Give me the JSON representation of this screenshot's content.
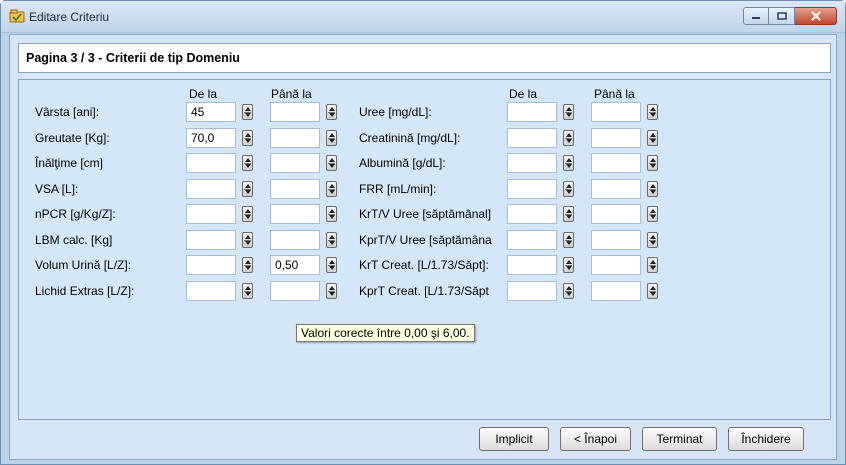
{
  "window": {
    "title": "Editare Criteriu"
  },
  "page_title": "Pagina 3 / 3 - Criterii de tip Domeniu",
  "col_headers": {
    "left_from": "De la",
    "left_to": "Până la",
    "right_from": "De la",
    "right_to": "Până la"
  },
  "left_rows": [
    {
      "label": "Vârsta [ani]:",
      "from": "45",
      "to": ""
    },
    {
      "label": "Greutate [Kg]:",
      "from": "70,0",
      "to": ""
    },
    {
      "label": "Înălţime [cm]",
      "from": "",
      "to": ""
    },
    {
      "label": "VSA [L]:",
      "from": "",
      "to": ""
    },
    {
      "label": "nPCR [g/Kg/Z]:",
      "from": "",
      "to": ""
    },
    {
      "label": "LBM calc. [Kg]",
      "from": "",
      "to": ""
    },
    {
      "label": "Volum Urină [L/Z]:",
      "from": "",
      "to": "0,50"
    },
    {
      "label": "Lichid Extras [L/Z]:",
      "from": "",
      "to": ""
    }
  ],
  "right_rows": [
    {
      "label": "Uree [mg/dL]:",
      "from": "",
      "to": ""
    },
    {
      "label": "Creatinină [mg/dL]:",
      "from": "",
      "to": ""
    },
    {
      "label": "Albumină [g/dL]:",
      "from": "",
      "to": ""
    },
    {
      "label": "FRR [mL/min]:",
      "from": "",
      "to": ""
    },
    {
      "label": "KrT/V Uree [săptămânal]",
      "from": "",
      "to": ""
    },
    {
      "label": "KprT/V Uree [săptămâna",
      "from": "",
      "to": ""
    },
    {
      "label": "KrT Creat. [L/1.73/Săpt]:",
      "from": "",
      "to": ""
    },
    {
      "label": "KprT Creat. [L/1.73/Săpt",
      "from": "",
      "to": ""
    }
  ],
  "tooltip": "Valori corecte între 0,00 şi 6,00.",
  "buttons": {
    "default": "Implicit",
    "back": "< Înapoi",
    "finish": "Terminat",
    "close": "Închidere"
  },
  "icons": {
    "app": "app-icon",
    "minimize": "minimize-icon",
    "maximize": "maximize-icon",
    "close": "close-icon",
    "spinner": "spinner-icon"
  },
  "colors": {
    "window_bg": "#bcd3ea",
    "panel_bg": "#d4e7f8",
    "tooltip_bg": "#ffffe1",
    "close_btn": "#c4462d"
  }
}
